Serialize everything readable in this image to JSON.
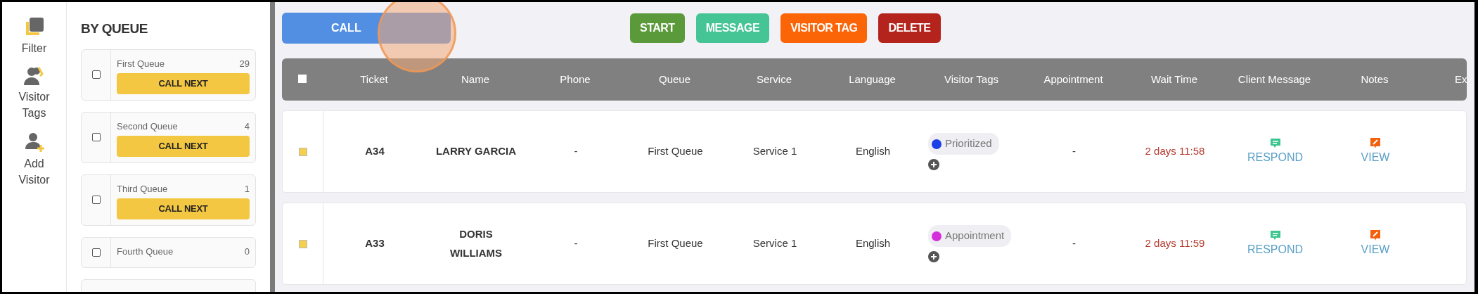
{
  "sidebar": {
    "items": [
      {
        "kind": "filter",
        "label": "Filter"
      },
      {
        "kind": "tags",
        "label": "Visitor Tags"
      },
      {
        "kind": "add",
        "label": "Add Visitor"
      }
    ]
  },
  "queue_panel": {
    "title": "BY QUEUE",
    "queues": [
      {
        "name": "First Queue",
        "count": "29",
        "button": "CALL NEXT",
        "checked": false
      },
      {
        "name": "Second Queue",
        "count": "4",
        "button": "CALL NEXT",
        "checked": false
      },
      {
        "name": "Third Queue",
        "count": "1",
        "button": "CALL NEXT",
        "checked": false
      },
      {
        "name": "Fourth Queue",
        "count": "0",
        "checked": false
      }
    ]
  },
  "toolbar": {
    "call_button": "CALL",
    "actions": [
      {
        "label": "START",
        "color": "#5b9a3b"
      },
      {
        "label": "MESSAGE",
        "color": "#45c495"
      },
      {
        "label": "VISITOR TAG",
        "color": "#fb6407"
      },
      {
        "label": "DELETE",
        "color": "#b5241c"
      }
    ]
  },
  "table": {
    "select_all_checked": false,
    "columns": [
      "Ticket",
      "Name",
      "Phone",
      "Queue",
      "Service",
      "Language",
      "Visitor Tags",
      "Appointment",
      "Wait Time",
      "Client Message",
      "Notes",
      "Ex"
    ],
    "rows": [
      {
        "checked": false,
        "ticket": "A34",
        "name": "LARRY GARCIA",
        "phone": "-",
        "queue": "First Queue",
        "service": "Service 1",
        "language": "English",
        "tags": [
          {
            "label": "Prioritized",
            "color": "#1a3fe6"
          }
        ],
        "appointment": "-",
        "wait_time": "2 days 11:58",
        "client_message": "RESPOND",
        "notes": "VIEW"
      },
      {
        "checked": false,
        "ticket": "A33",
        "name": "DORIS WILLIAMS",
        "phone": "-",
        "queue": "First Queue",
        "service": "Service 1",
        "language": "English",
        "tags": [
          {
            "label": "Appointment",
            "color": "#d42ddb"
          }
        ],
        "appointment": "-",
        "wait_time": "2 days 11:59",
        "client_message": "RESPOND",
        "notes": "VIEW"
      }
    ]
  }
}
